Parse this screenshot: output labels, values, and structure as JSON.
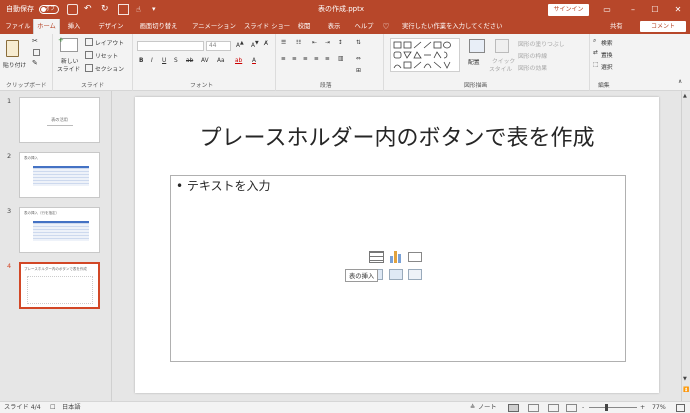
{
  "titlebar": {
    "autosave": "自動保存",
    "autosave_state": "オフ",
    "title": "表の作成.pptx",
    "signin": "サインイン",
    "minimize": "–",
    "maximize": "☐",
    "close": "✕"
  },
  "tabs": [
    "ファイル",
    "ホーム",
    "挿入",
    "デザイン",
    "画面切り替え",
    "アニメーション",
    "スライド ショー",
    "校閲",
    "表示",
    "ヘルプ"
  ],
  "tell_me": "実行したい作業を入力してください",
  "share": "共有",
  "comment": "コメント",
  "ribbon": {
    "clipboard": {
      "paste": "貼り付け",
      "label": "クリップボード"
    },
    "slides": {
      "new_slide": "新しい",
      "new_slide2": "スライド",
      "layout": "レイアウト",
      "reset": "リセット",
      "section": "セクション",
      "label": "スライド"
    },
    "font": {
      "font_name": "",
      "font_size": "44",
      "label": "フォント"
    },
    "paragraph": {
      "label": "段落"
    },
    "drawing": {
      "arrange": "配置",
      "quick_style": "クイック",
      "quick_style2": "スタイル",
      "fill": "図形の塗りつぶし",
      "outline": "図形の枠線",
      "effect": "図形の効果",
      "label": "図形描画"
    },
    "editing": {
      "find": "検索",
      "replace": "置換",
      "select": "選択",
      "label": "編集"
    }
  },
  "thumbnails": [
    {
      "num": "1",
      "title": "表の活用"
    },
    {
      "num": "2",
      "title": "表の挿入"
    },
    {
      "num": "3",
      "title": "表の挿入（行を指定）"
    },
    {
      "num": "4",
      "title": "プレースホルダー内のボタンで表を作成"
    }
  ],
  "slide": {
    "title": "プレースホルダー内のボタンで表を作成",
    "bullet": "• テキストを入力",
    "tooltip": "表の挿入"
  },
  "status": {
    "slide_counter": "スライド 4/4",
    "language": "日本語",
    "notes": "ノート",
    "zoom": "77%",
    "zoom_minus": "-",
    "zoom_plus": "+"
  },
  "colors": {
    "accent": "#b7472a",
    "selected_thumb": "#d24726"
  }
}
